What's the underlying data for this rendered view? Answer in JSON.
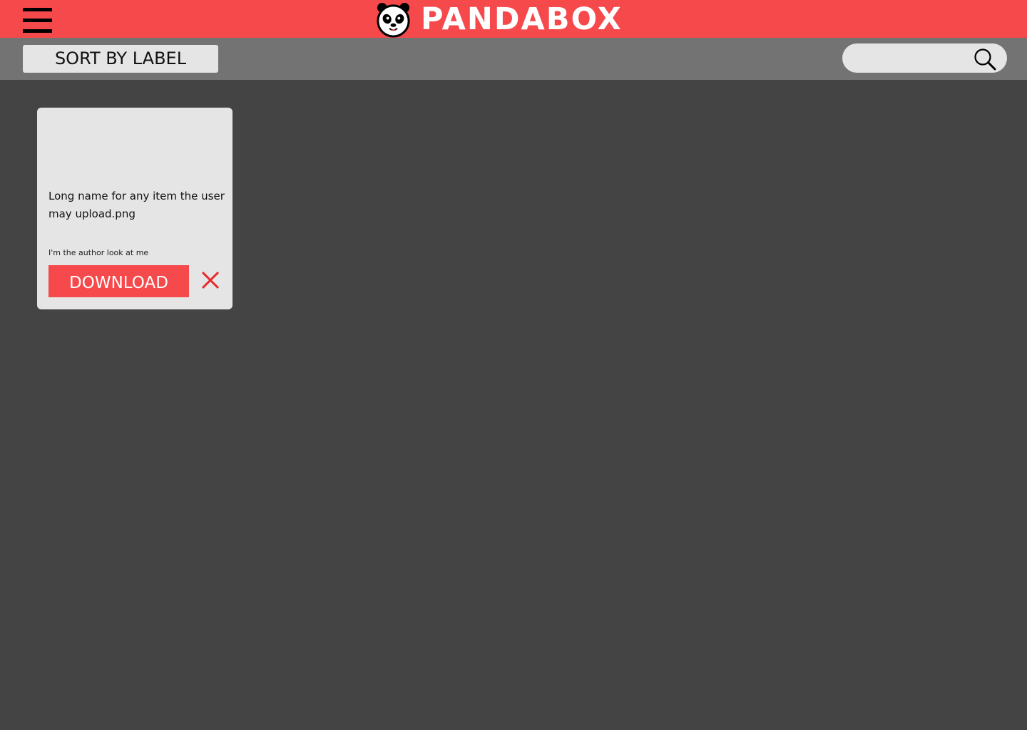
{
  "header": {
    "menu_icon": "hamburger-menu-icon",
    "logo_icon": "panda-logo-icon",
    "brand_name": "PANDABOX",
    "accent_color": "#f5494b"
  },
  "toolbar": {
    "sort_label": "SORT BY LABEL",
    "search": {
      "value": "",
      "placeholder": "",
      "icon": "search-icon"
    }
  },
  "files": [
    {
      "name": "Long name for any item the user may upload.png",
      "author": "I'm the author look at me",
      "download_label": "DOWNLOAD",
      "delete_icon": "close-icon"
    }
  ]
}
